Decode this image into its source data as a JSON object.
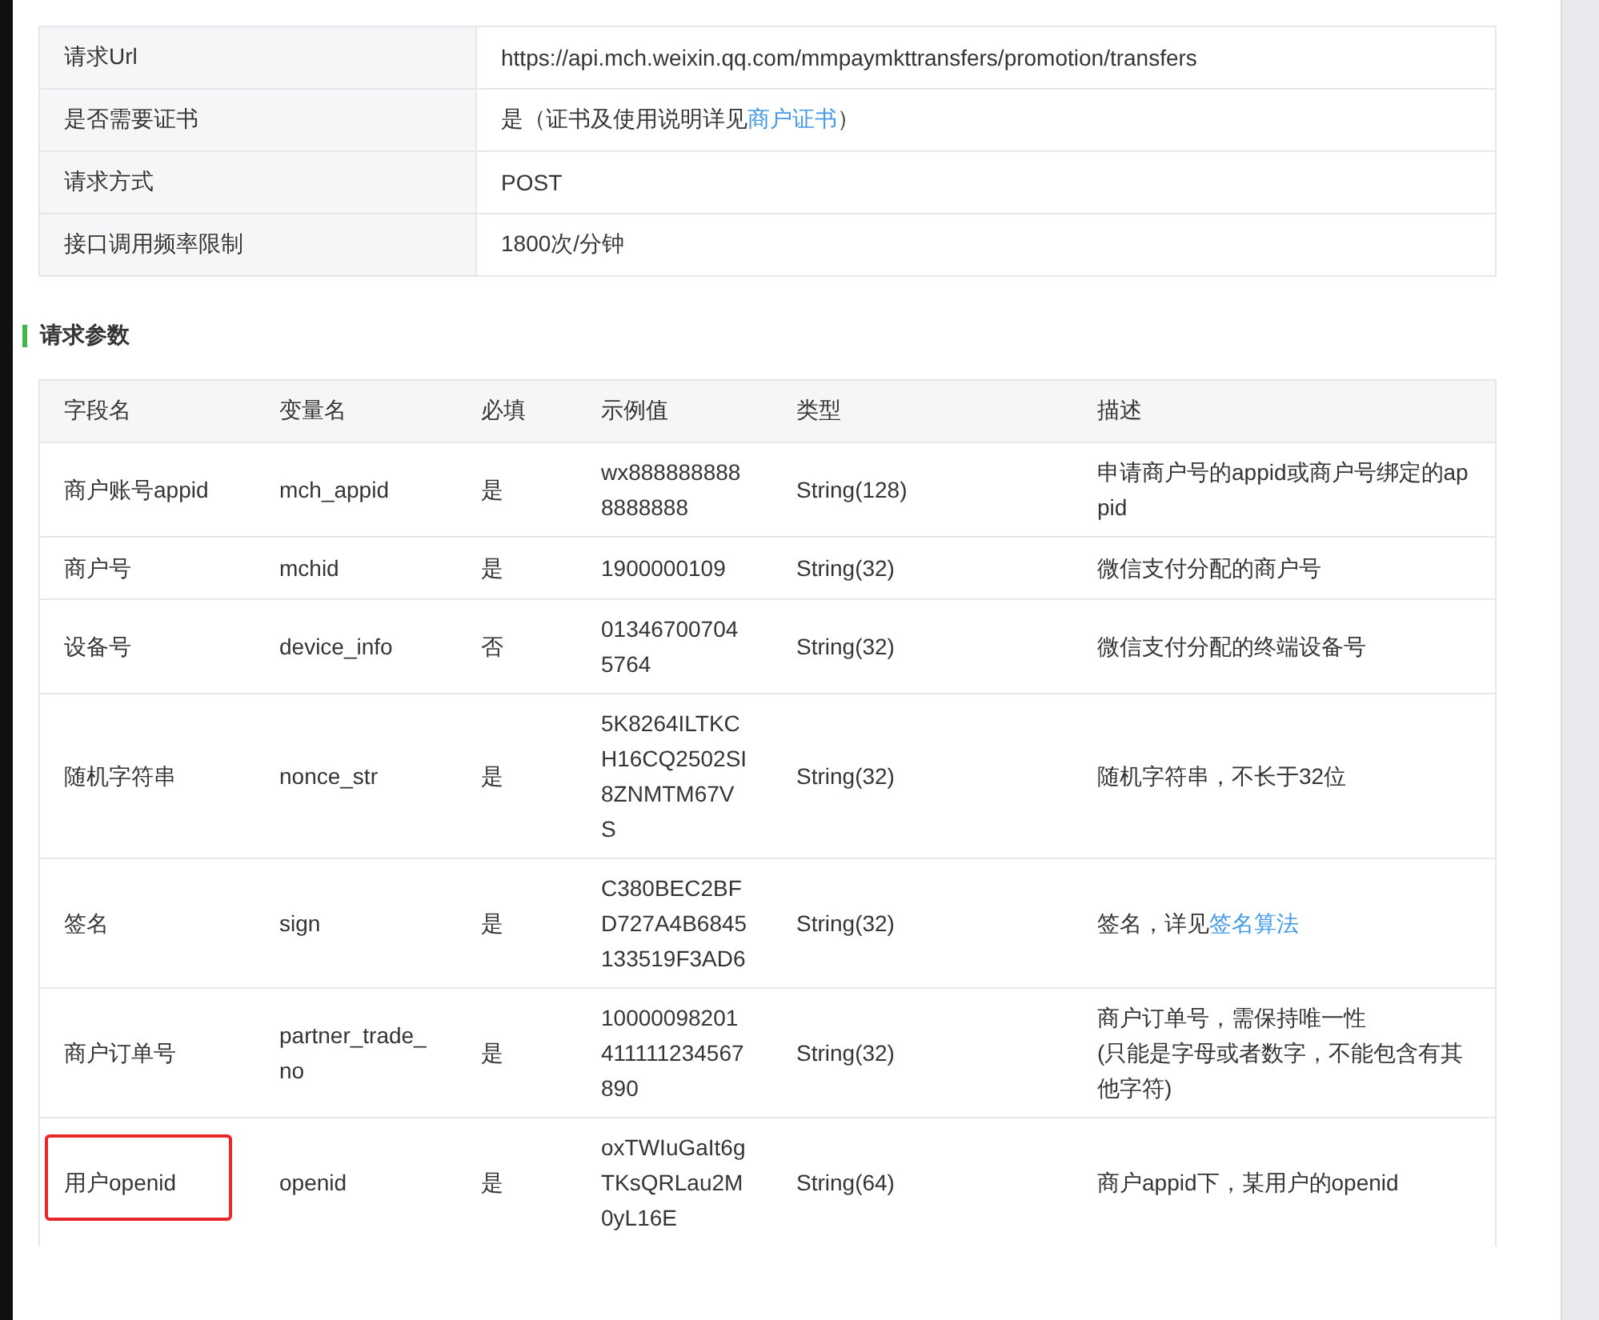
{
  "info_table": {
    "rows": [
      {
        "label": "请求Url",
        "value": [
          {
            "text": "https://api.mch.weixin.qq.com/mmpaymkttransfers/promotion/transfers",
            "link": false
          }
        ]
      },
      {
        "label": "是否需要证书",
        "value": [
          {
            "text": "是（证书及使用说明详见",
            "link": false
          },
          {
            "text": "商户证书",
            "link": true
          },
          {
            "text": "）",
            "link": false
          }
        ]
      },
      {
        "label": "请求方式",
        "value": [
          {
            "text": "POST",
            "link": false
          }
        ]
      },
      {
        "label": "接口调用频率限制",
        "value": [
          {
            "text": "1800次/分钟",
            "link": false
          }
        ]
      }
    ]
  },
  "section_title": "请求参数",
  "params_table": {
    "columns": [
      "字段名",
      "变量名",
      "必填",
      "示例值",
      "类型",
      "描述"
    ],
    "rows": [
      {
        "field": "商户账号appid",
        "variable": "mch_appid",
        "required": "是",
        "example": "wx8888888888888888",
        "type": "String(128)",
        "description": [
          {
            "text": "申请商户号的appid或商户号绑定的appid",
            "link": false
          }
        ],
        "highlighted": false
      },
      {
        "field": "商户号",
        "variable": "mchid",
        "required": "是",
        "example": "1900000109",
        "type": "String(32)",
        "description": [
          {
            "text": "微信支付分配的商户号",
            "link": false
          }
        ],
        "highlighted": false
      },
      {
        "field": "设备号",
        "variable": "device_info",
        "required": "否",
        "example": "013467007045764",
        "type": "String(32)",
        "description": [
          {
            "text": "微信支付分配的终端设备号",
            "link": false
          }
        ],
        "highlighted": false
      },
      {
        "field": "随机字符串",
        "variable": "nonce_str",
        "required": "是",
        "example": "5K8264ILTKCH16CQ2502SI8ZNMTM67VS",
        "type": "String(32)",
        "description": [
          {
            "text": "随机字符串，不长于32位",
            "link": false
          }
        ],
        "highlighted": false
      },
      {
        "field": "签名",
        "variable": "sign",
        "required": "是",
        "example": "C380BEC2BFD727A4B6845133519F3AD6",
        "type": "String(32)",
        "description": [
          {
            "text": "签名，详见",
            "link": false
          },
          {
            "text": "签名算法",
            "link": true
          }
        ],
        "highlighted": false
      },
      {
        "field": "商户订单号",
        "variable": "partner_trade_no",
        "required": "是",
        "example": "10000098201411111234567890",
        "type": "String(32)",
        "description": [
          {
            "text": "商户订单号，需保持唯一性\n(只能是字母或者数字，不能包含有其他字符)",
            "link": false
          }
        ],
        "highlighted": false
      },
      {
        "field": "用户openid",
        "variable": "openid",
        "required": "是",
        "example": "oxTWIuGaIt6gTKsQRLau2M0yL16E",
        "type": "String(64)",
        "description": [
          {
            "text": "商户appid下，某用户的openid",
            "link": false
          }
        ],
        "highlighted": true
      }
    ]
  }
}
